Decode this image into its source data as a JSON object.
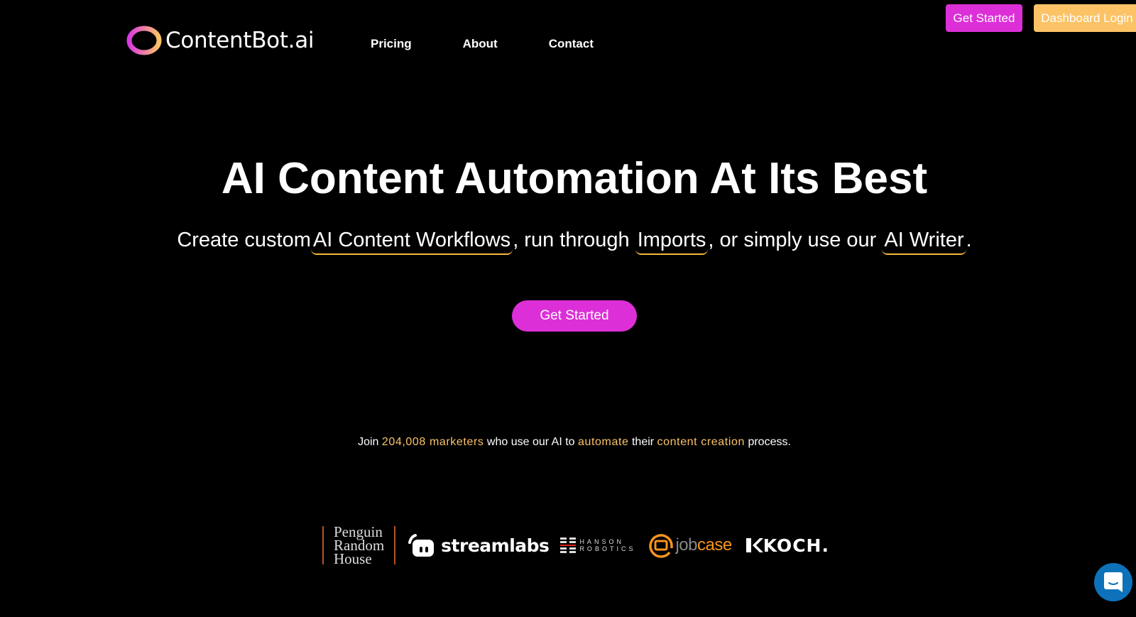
{
  "header": {
    "logo_text": "ContentBot.ai",
    "nav": [
      "Pricing",
      "About",
      "Contact"
    ],
    "get_started": "Get Started",
    "dashboard_login": "Dashboard Login"
  },
  "hero": {
    "title": "AI Content Automation At Its Best",
    "sub_prefix": "Create custom",
    "link1": "AI Content Workflows",
    "sub_mid1": ", run through ",
    "link2": "Imports",
    "sub_mid2": ", or simply use our ",
    "link3": "AI Writer",
    "sub_suffix": ".",
    "cta": "Get Started"
  },
  "social_proof": {
    "p1": "Join ",
    "count": "204,008 marketers",
    "p2": " who use our AI to ",
    "h2": "automate",
    "p3": " their ",
    "h3": "content creation",
    "p4": " process."
  },
  "logos": {
    "penguin": [
      "Penguin",
      "Random",
      "House"
    ],
    "streamlabs": "streamlabs",
    "hanson": [
      "HANSON",
      "ROBOTICS"
    ],
    "jobcase_a": "job",
    "jobcase_b": "case",
    "koch": "KOCH."
  },
  "colors": {
    "magenta": "#dc2fd7",
    "gold": "#fbc366",
    "chat": "#0d72b9"
  }
}
